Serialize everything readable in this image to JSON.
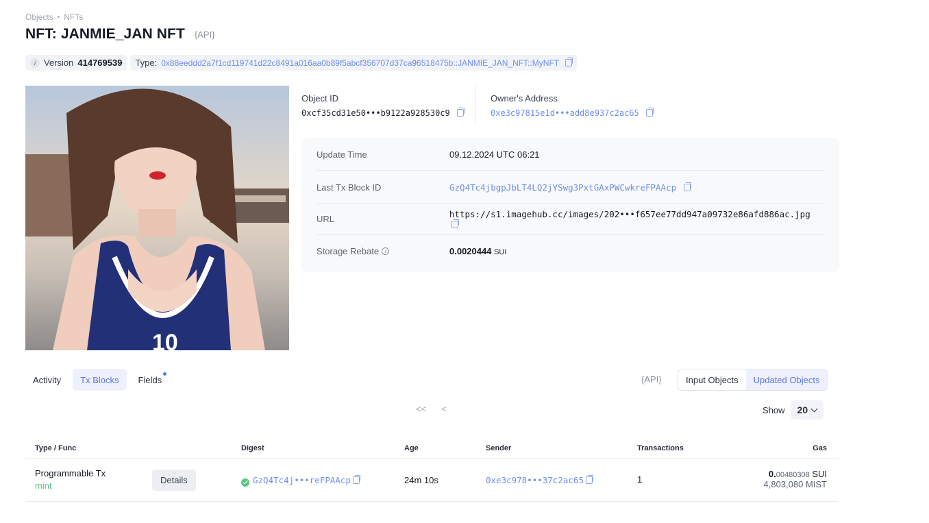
{
  "breadcrumb": [
    "Objects",
    "NFTs"
  ],
  "title": "NFT: JANMIE_JAN NFT",
  "api_badge": "{API}",
  "version": {
    "label": "Version",
    "value": "414769539"
  },
  "type": {
    "label": "Type:",
    "value": "0x88eeddd2a7f1cd119741d22c8491a016aa0b89f5abcf356707d37ca96518475b::JANMIE_JAN_NFT::MyNFT"
  },
  "object_id": {
    "label": "Object ID",
    "value": "0xcf35cd31e50•••b9122a928530c9"
  },
  "owner": {
    "label": "Owner's Address",
    "value": "0xe3c97815e1d•••add8e937c2ac65"
  },
  "details": {
    "update_time": {
      "label": "Update Time",
      "value": "09.12.2024 UTC 06:21"
    },
    "last_tx": {
      "label": "Last Tx Block ID",
      "value": "GzQ4Tc4jbgpJbLT4LQ2jYSwg3PxtGAxPWCwkreFPAAcp"
    },
    "url": {
      "label": "URL",
      "value": "https://s1.imagehub.cc/images/202•••f657ee77dd947a09732e86afd886ac.jpg"
    },
    "storage_rebate": {
      "label": "Storage Rebate",
      "value": "0.0020444",
      "unit": "SUI"
    }
  },
  "tabs": [
    "Activity",
    "Tx Blocks",
    "Fields"
  ],
  "api_small": "{API}",
  "segment": [
    "Input Objects",
    "Updated Objects"
  ],
  "pager": {
    "first": "<<",
    "prev": "<"
  },
  "show": {
    "label": "Show",
    "value": "20"
  },
  "table": {
    "headers": [
      "Type / Func",
      "Digest",
      "Age",
      "Sender",
      "Transactions",
      "Gas"
    ],
    "rows": [
      {
        "type": "Programmable Tx",
        "func": "mint",
        "details_label": "Details",
        "digest": "GzQ4Tc4j•••reFPAAcp",
        "age": "24m 10s",
        "sender": "0xe3c978•••37c2ac65",
        "transactions": "1",
        "gas_main": "0.",
        "gas_fraction": "00480308",
        "gas_unit": "SUI",
        "gas_mist": "4,803,080 MIST"
      }
    ]
  }
}
